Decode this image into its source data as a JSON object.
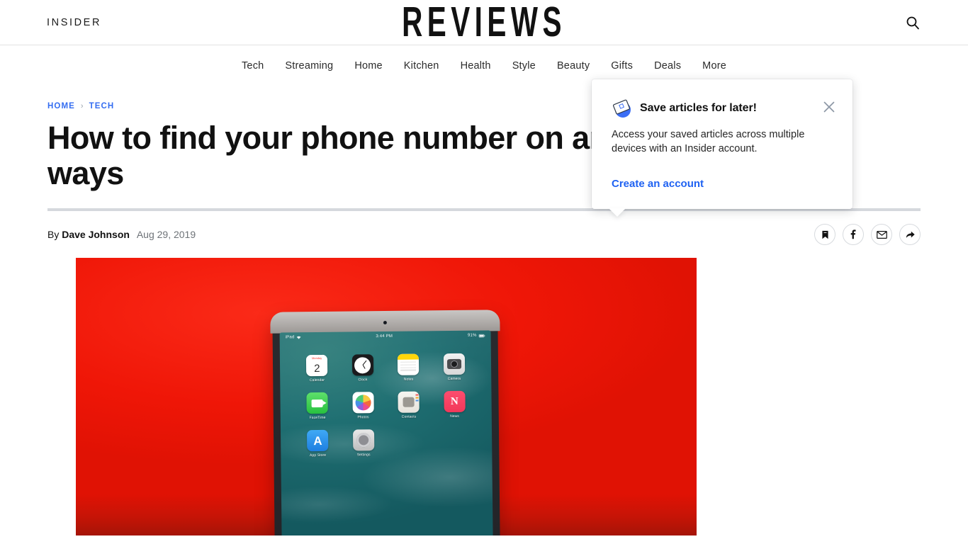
{
  "header": {
    "brand_left": "INSIDER",
    "brand_center": "REVIEWS",
    "search_icon": "search-icon"
  },
  "nav": {
    "items": [
      {
        "label": "Tech"
      },
      {
        "label": "Streaming"
      },
      {
        "label": "Home"
      },
      {
        "label": "Kitchen"
      },
      {
        "label": "Health"
      },
      {
        "label": "Style"
      },
      {
        "label": "Beauty"
      },
      {
        "label": "Gifts"
      },
      {
        "label": "Deals"
      },
      {
        "label": "More"
      }
    ]
  },
  "article": {
    "breadcrumb": {
      "home": "HOME",
      "separator": "›",
      "section": "TECH"
    },
    "headline": "How to find your phone number on an iPhone in 2 ways",
    "byline": {
      "prefix": "By",
      "author": "Dave Johnson",
      "date": "Aug 29, 2019"
    },
    "share_buttons": [
      {
        "name": "bookmark-icon",
        "label": "Save"
      },
      {
        "name": "facebook-icon",
        "label": "f"
      },
      {
        "name": "email-icon",
        "label": "Email"
      },
      {
        "name": "share-icon",
        "label": "Share"
      }
    ]
  },
  "hero": {
    "alt": "iPad on a red background showing the home screen",
    "device": {
      "status_bar": {
        "carrier": "iPad",
        "wifi_icon": "wifi-icon",
        "time": "3:44 PM",
        "battery": "91%",
        "battery_icon": "battery-icon"
      },
      "apps": [
        {
          "label": "Calendar",
          "icon": "calendar-icon",
          "day": "Monday",
          "date": "2"
        },
        {
          "label": "Clock",
          "icon": "clock-icon"
        },
        {
          "label": "Notes",
          "icon": "notes-icon"
        },
        {
          "label": "Camera",
          "icon": "camera-icon"
        },
        {
          "label": "FaceTime",
          "icon": "facetime-icon"
        },
        {
          "label": "Photos",
          "icon": "photos-icon"
        },
        {
          "label": "Contacts",
          "icon": "contacts-icon"
        },
        {
          "label": "News",
          "icon": "news-icon",
          "glyph": "N"
        },
        {
          "label": "App Store",
          "icon": "app-store-icon",
          "glyph": "A"
        },
        {
          "label": "Settings",
          "icon": "settings-icon"
        }
      ]
    }
  },
  "save_popup": {
    "icon": "save-article-icon",
    "title": "Save articles for later!",
    "body": "Access your saved articles across multiple devices with an Insider account.",
    "link": "Create an account",
    "close_icon": "close-icon"
  },
  "colors": {
    "link_blue": "#1f62f2",
    "breadcrumb_blue": "#346df1",
    "hero_red": "#f21c0d",
    "rule_gray": "#d5d8dd"
  }
}
